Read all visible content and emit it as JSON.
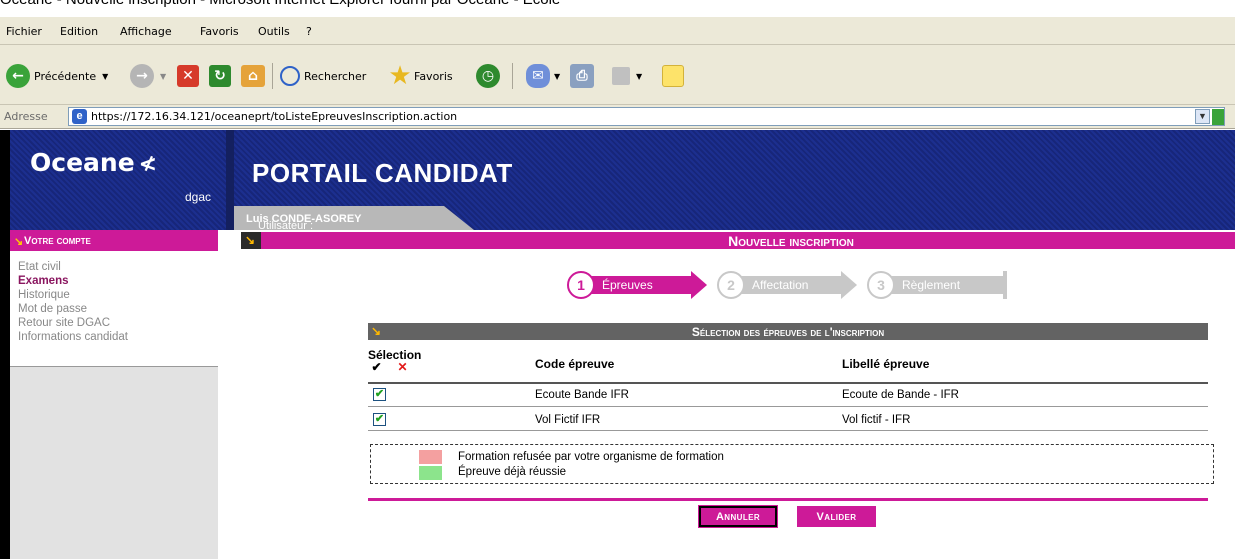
{
  "window": {
    "title": "Oceane - Nouvelle inscription - Microsoft Internet Explorer fourni par Oceane - Ecole"
  },
  "menu": {
    "items": [
      "Fichier",
      "Edition",
      "Affichage",
      "Favoris",
      "Outils",
      "?"
    ]
  },
  "toolbar": {
    "back_label": "Précédente",
    "search_label": "Rechercher",
    "favorites_label": "Favoris"
  },
  "address": {
    "label": "Adresse",
    "url": "https://172.16.34.121/oceaneprt/toListeEpreuvesInscription.action"
  },
  "site": {
    "logo_text": "Oceane",
    "logo_sub": "dgac",
    "portal_title": "PORTAIL CANDIDAT",
    "user_label": "Utilisateur :",
    "user_name": "Luis CONDE-ASOREY"
  },
  "sidebar": {
    "title": "Votre compte",
    "items": [
      {
        "label": "Etat civil",
        "active": false
      },
      {
        "label": "Examens",
        "active": true
      },
      {
        "label": "Historique",
        "active": false
      },
      {
        "label": "Mot de passe",
        "active": false
      },
      {
        "label": "Retour site DGAC",
        "active": false
      },
      {
        "label": "Informations candidat",
        "active": false
      }
    ]
  },
  "main": {
    "section_title": "Nouvelle inscription",
    "steps": [
      {
        "number": "1",
        "label": "Épreuves",
        "active": true
      },
      {
        "number": "2",
        "label": "Affectation",
        "active": false
      },
      {
        "number": "3",
        "label": "Règlement",
        "active": false
      }
    ],
    "table": {
      "title": "Sélection des épreuves de l'inscription",
      "headers": [
        "Sélection",
        "Code épreuve",
        "Libellé épreuve"
      ],
      "rows": [
        {
          "selected": true,
          "code": "Ecoute Bande IFR",
          "label": "Ecoute de Bande - IFR"
        },
        {
          "selected": true,
          "code": "Vol Fictif IFR",
          "label": "Vol fictif - IFR"
        }
      ]
    },
    "legend": [
      {
        "color": "#f4a0a0",
        "text": "Formation refusée par votre organisme de formation"
      },
      {
        "color": "#8ce48c",
        "text": "Épreuve déjà réussie"
      }
    ],
    "buttons": {
      "cancel": "Annuler",
      "validate": "Valider"
    }
  },
  "colors": {
    "accent": "#cd1a98",
    "header_blue": "#1c2f8f",
    "step_active": "#cd1a98",
    "step_inactive": "#c8c8c8"
  }
}
